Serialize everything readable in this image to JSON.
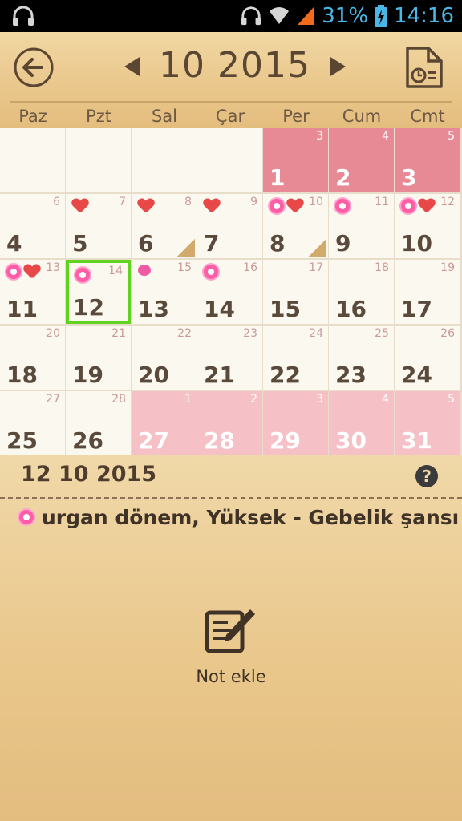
{
  "status_bar": {
    "battery": "31%",
    "time": "14:16"
  },
  "header": {
    "month_title": "10 2015",
    "weekdays": [
      "Paz",
      "Pzt",
      "Sal",
      "Çar",
      "Per",
      "Cum",
      "Cmt"
    ]
  },
  "calendar": {
    "weeks": [
      [
        {
          "day": "",
          "small": "",
          "type": "empty"
        },
        {
          "day": "",
          "small": "",
          "type": "empty"
        },
        {
          "day": "",
          "small": "",
          "type": "empty"
        },
        {
          "day": "",
          "small": "",
          "type": "empty"
        },
        {
          "day": "1",
          "small": "3",
          "type": "period"
        },
        {
          "day": "2",
          "small": "4",
          "type": "period"
        },
        {
          "day": "3",
          "small": "5",
          "type": "period"
        }
      ],
      [
        {
          "day": "4",
          "small": "6",
          "type": "normal"
        },
        {
          "day": "5",
          "small": "7",
          "type": "normal",
          "marks": [
            "heart"
          ]
        },
        {
          "day": "6",
          "small": "8",
          "type": "normal",
          "marks": [
            "heart"
          ],
          "note": true
        },
        {
          "day": "7",
          "small": "9",
          "type": "normal",
          "marks": [
            "heart"
          ]
        },
        {
          "day": "8",
          "small": "10",
          "type": "normal",
          "marks": [
            "flower",
            "heart"
          ],
          "note": true
        },
        {
          "day": "9",
          "small": "11",
          "type": "normal",
          "marks": [
            "flower"
          ]
        },
        {
          "day": "10",
          "small": "12",
          "type": "normal",
          "marks": [
            "flower",
            "heart"
          ]
        }
      ],
      [
        {
          "day": "11",
          "small": "13",
          "type": "normal",
          "marks": [
            "flower",
            "heart"
          ]
        },
        {
          "day": "12",
          "small": "14",
          "type": "today",
          "marks": [
            "flower"
          ]
        },
        {
          "day": "13",
          "small": "15",
          "type": "normal",
          "marks": [
            "drop"
          ]
        },
        {
          "day": "14",
          "small": "16",
          "type": "normal",
          "marks": [
            "flower"
          ]
        },
        {
          "day": "15",
          "small": "17",
          "type": "normal"
        },
        {
          "day": "16",
          "small": "18",
          "type": "normal"
        },
        {
          "day": "17",
          "small": "19",
          "type": "normal"
        }
      ],
      [
        {
          "day": "18",
          "small": "20",
          "type": "normal"
        },
        {
          "day": "19",
          "small": "21",
          "type": "normal"
        },
        {
          "day": "20",
          "small": "22",
          "type": "normal"
        },
        {
          "day": "21",
          "small": "23",
          "type": "normal"
        },
        {
          "day": "22",
          "small": "24",
          "type": "normal"
        },
        {
          "day": "23",
          "small": "25",
          "type": "normal"
        },
        {
          "day": "24",
          "small": "26",
          "type": "normal"
        }
      ],
      [
        {
          "day": "25",
          "small": "27",
          "type": "normal"
        },
        {
          "day": "26",
          "small": "28",
          "type": "normal"
        },
        {
          "day": "27",
          "small": "1",
          "type": "pred"
        },
        {
          "day": "28",
          "small": "2",
          "type": "pred"
        },
        {
          "day": "29",
          "small": "3",
          "type": "pred"
        },
        {
          "day": "30",
          "small": "4",
          "type": "pred"
        },
        {
          "day": "31",
          "small": "5",
          "type": "pred"
        }
      ]
    ]
  },
  "detail": {
    "selected_date": "12 10 2015",
    "help_label": "?",
    "status_text": "urgan dönem, Yüksek - Gebelik şansı",
    "add_note_label": "Not ekle"
  },
  "colors": {
    "period": "#e78a96",
    "predicted": "#f6c1c6",
    "today_border": "#5fd320",
    "accent_text": "#5a4632"
  },
  "icons": {
    "back": "back-arrow-icon",
    "prev": "prev-triangle-icon",
    "next": "next-triangle-icon",
    "report": "report-document-icon",
    "help": "help-icon",
    "add_note": "edit-note-icon"
  }
}
